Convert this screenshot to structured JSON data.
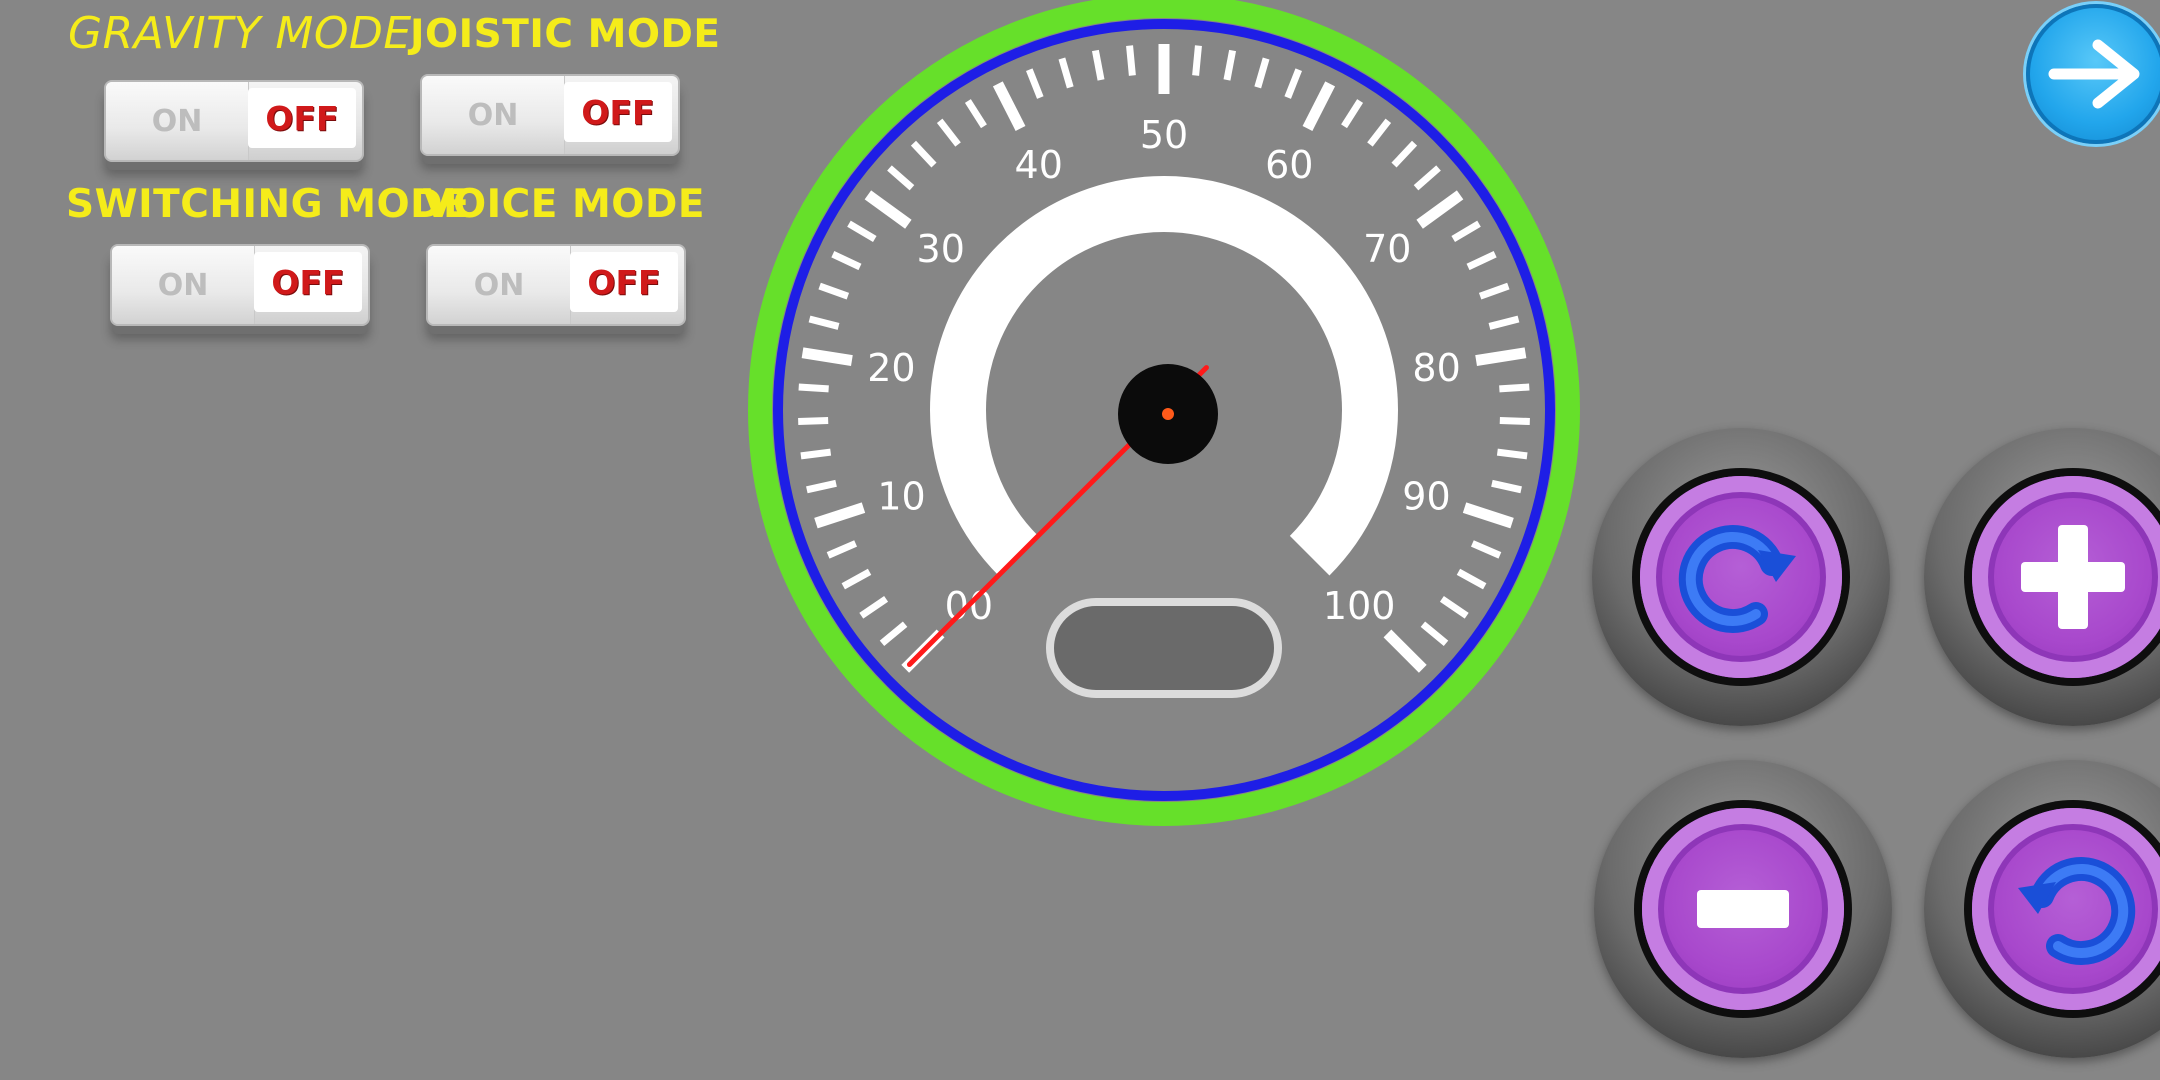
{
  "modes": {
    "gravity_label": "GRAVITY MODE",
    "joistic_label": "JOISTIC MODE",
    "switching_label": "SWITCHING MODE",
    "voice_label": "VOICE MODE",
    "toggle_on": "ON",
    "toggle_off": "OFF",
    "gravity_state": "OFF",
    "joistic_state": "OFF",
    "switching_state": "OFF",
    "voice_state": "OFF"
  },
  "speedometer": {
    "tick_labels": [
      "00",
      "10",
      "20",
      "30",
      "40",
      "50",
      "60",
      "70",
      "80",
      "90",
      "100"
    ],
    "min": 0,
    "max": 100,
    "current_value": 0,
    "readout": "",
    "colors": {
      "outer_ring": "#66e02a",
      "inner_ring": "#1e1ee6",
      "needle": "#ff1a1a",
      "face": "#868686"
    }
  },
  "controls": {
    "next_button_icon": "arrow-right-icon",
    "rotate_cw_icon": "rotate-clockwise-icon",
    "plus_icon": "plus-icon",
    "minus_icon": "minus-icon",
    "rotate_ccw_icon": "rotate-counterclockwise-icon"
  }
}
